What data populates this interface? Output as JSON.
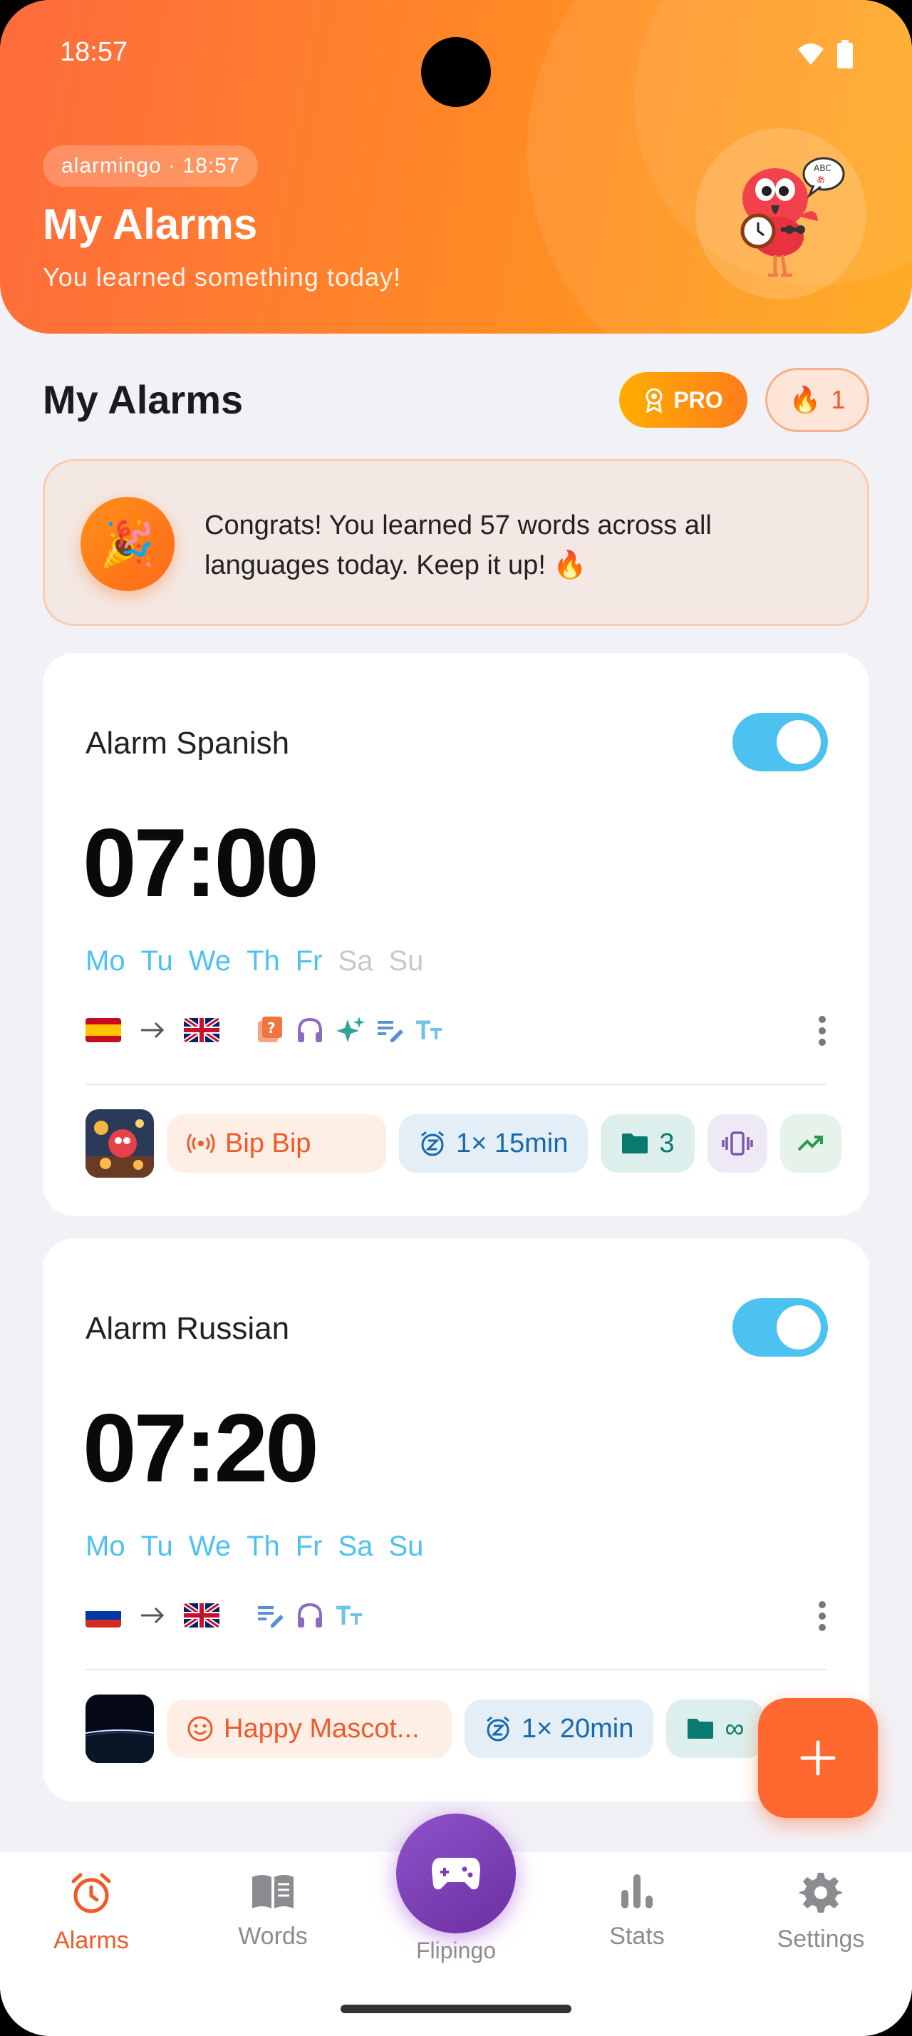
{
  "status_bar": {
    "time": "18:57"
  },
  "header": {
    "app_chip": "alarmingo · 18:57",
    "title": "My Alarms",
    "subtitle": "You learned something today!"
  },
  "section": {
    "title": "My Alarms",
    "pro_label": "PRO",
    "streak_count": "1"
  },
  "congrats": {
    "text": "Congrats! You learned 57 words across all languages today. Keep it up! 🔥"
  },
  "alarms": [
    {
      "name": "Alarm Spanish",
      "time": "07:00",
      "enabled": true,
      "days": [
        {
          "label": "Mo",
          "on": true
        },
        {
          "label": "Tu",
          "on": true
        },
        {
          "label": "We",
          "on": true
        },
        {
          "label": "Th",
          "on": true
        },
        {
          "label": "Fr",
          "on": true
        },
        {
          "label": "Sa",
          "on": false
        },
        {
          "label": "Su",
          "on": false
        }
      ],
      "from_flag": "spain-flag-icon",
      "to_flag": "uk-flag-icon",
      "feature_icons": [
        "quiz-icon",
        "headphones-icon",
        "sparkle-icon",
        "write-icon",
        "text-size-icon"
      ],
      "sound": "Bip Bip",
      "snooze": "1× 15min",
      "folders": "3"
    },
    {
      "name": "Alarm Russian",
      "time": "07:20",
      "enabled": true,
      "days": [
        {
          "label": "Mo",
          "on": true
        },
        {
          "label": "Tu",
          "on": true
        },
        {
          "label": "We",
          "on": true
        },
        {
          "label": "Th",
          "on": true
        },
        {
          "label": "Fr",
          "on": true
        },
        {
          "label": "Sa",
          "on": true
        },
        {
          "label": "Su",
          "on": true
        }
      ],
      "from_flag": "russia-flag-icon",
      "to_flag": "uk-flag-icon",
      "feature_icons": [
        "write-icon",
        "headphones-icon",
        "text-size-icon"
      ],
      "sound": "Happy Mascot...",
      "snooze": "1× 20min",
      "folders": "∞"
    }
  ],
  "nav": {
    "alarms": "Alarms",
    "words": "Words",
    "center": "Flipingo",
    "stats": "Stats",
    "settings": "Settings"
  },
  "colors": {
    "accent": "#ff6930",
    "toggle_on": "#4cc2f1",
    "day_on": "#4cc2f1",
    "day_off": "#c8c8cc",
    "center_button": "#7d3fb8"
  }
}
